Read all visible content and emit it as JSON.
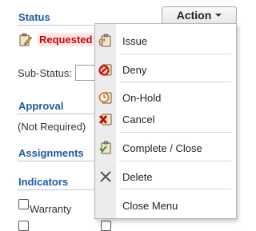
{
  "status": {
    "title": "Status",
    "value": "Requested",
    "icon": "clipboard-pencil-icon",
    "substatus_label": "Sub-Status:"
  },
  "approval": {
    "title": "Approval",
    "value": "(Not Required)"
  },
  "assignments": {
    "title": "Assignments"
  },
  "indicators": {
    "title": "Indicators",
    "warranty_label": "Warranty"
  },
  "action_button": {
    "label": "Action"
  },
  "menu": {
    "items": [
      {
        "label": "Issue",
        "icon": "clipboard-hand-icon"
      },
      {
        "label": "Deny",
        "icon": "deny-circle-icon"
      },
      {
        "label": "On-Hold",
        "icon": "clock-clipboard-icon"
      },
      {
        "label": "Cancel",
        "icon": "cancel-x-icon"
      },
      {
        "label": "Complete / Close",
        "icon": "clipboard-check-icon"
      },
      {
        "label": "Delete",
        "icon": "delete-x-icon"
      },
      {
        "label": "Close Menu",
        "icon": ""
      }
    ]
  },
  "colors": {
    "section_title": "#1f5aa6",
    "status_text": "#d00000"
  }
}
